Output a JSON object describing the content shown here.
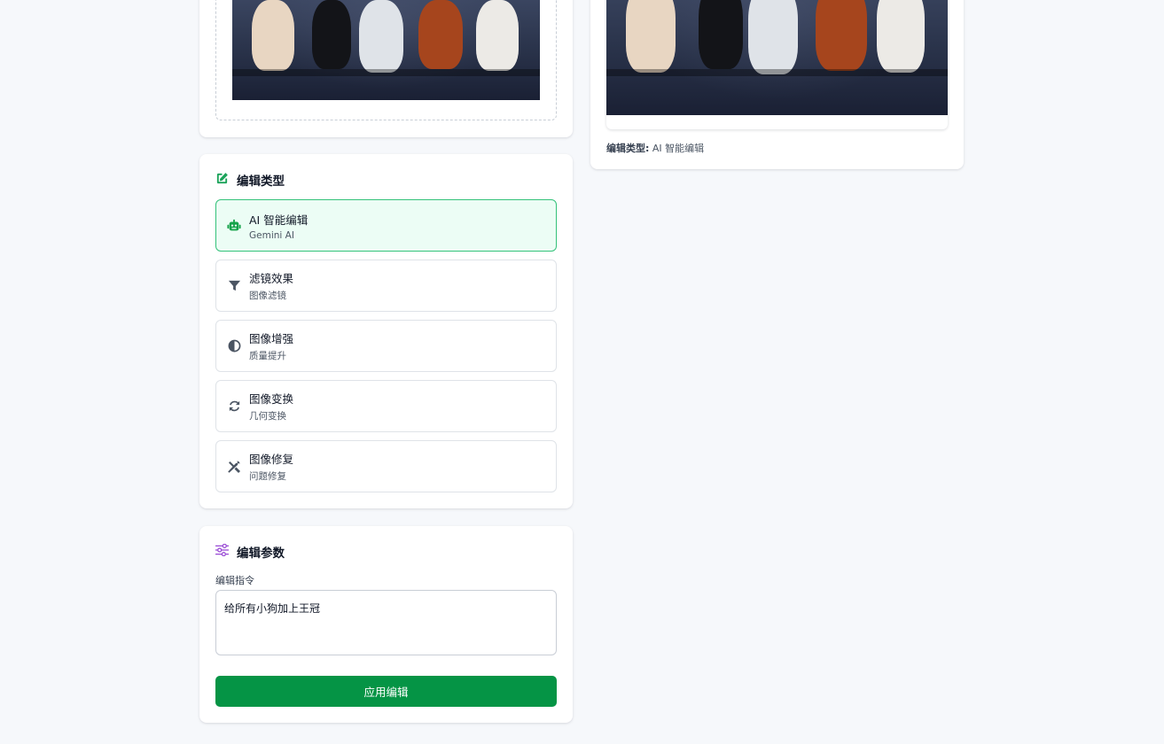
{
  "colors": {
    "accent_green": "#059445",
    "active_option_bg": "#ecfdf5",
    "active_option_border": "#34c27a",
    "params_icon_purple": "#9b4dd6",
    "page_bg": "#f6f8fb"
  },
  "upload": {
    "image_icon": "dogs-photo"
  },
  "result": {
    "caption_key": "编辑类型:",
    "caption_value": "AI 智能编辑"
  },
  "edit_type": {
    "title": "编辑类型",
    "icon": "pen-square-icon",
    "options": [
      {
        "title": "AI 智能编辑",
        "subtitle": "Gemini AI",
        "icon": "robot-icon",
        "active": true
      },
      {
        "title": "滤镜效果",
        "subtitle": "图像滤镜",
        "icon": "filter-icon",
        "active": false
      },
      {
        "title": "图像增强",
        "subtitle": "质量提升",
        "icon": "contrast-icon",
        "active": false
      },
      {
        "title": "图像变换",
        "subtitle": "几何变换",
        "icon": "sync-icon",
        "active": false
      },
      {
        "title": "图像修复",
        "subtitle": "问题修复",
        "icon": "tools-icon",
        "active": false
      }
    ]
  },
  "params": {
    "title": "编辑参数",
    "icon": "sliders-icon",
    "instruction_label": "编辑指令",
    "instruction_value": "给所有小狗加上王冠",
    "apply_label": "应用编辑"
  }
}
